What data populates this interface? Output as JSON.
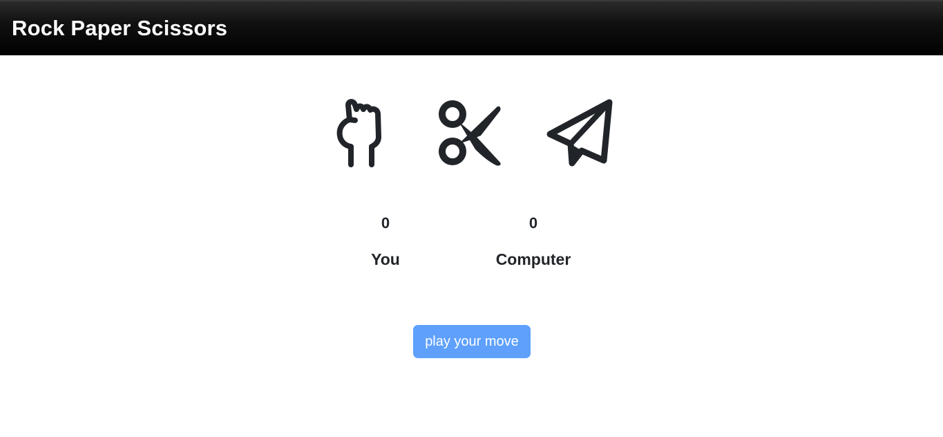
{
  "navbar": {
    "brand": "Rock Paper Scissors"
  },
  "moves": [
    {
      "name": "rock",
      "icon": "hand-fist-icon"
    },
    {
      "name": "scissors",
      "icon": "scissors-icon"
    },
    {
      "name": "paper",
      "icon": "paper-plane-icon"
    }
  ],
  "scores": {
    "you": {
      "value": "0",
      "label": "You"
    },
    "computer": {
      "value": "0",
      "label": "Computer"
    }
  },
  "play_button": {
    "label": "play your move"
  },
  "colors": {
    "icon": "#212529",
    "button": "#5ea0fc",
    "navbar": "#000000"
  }
}
